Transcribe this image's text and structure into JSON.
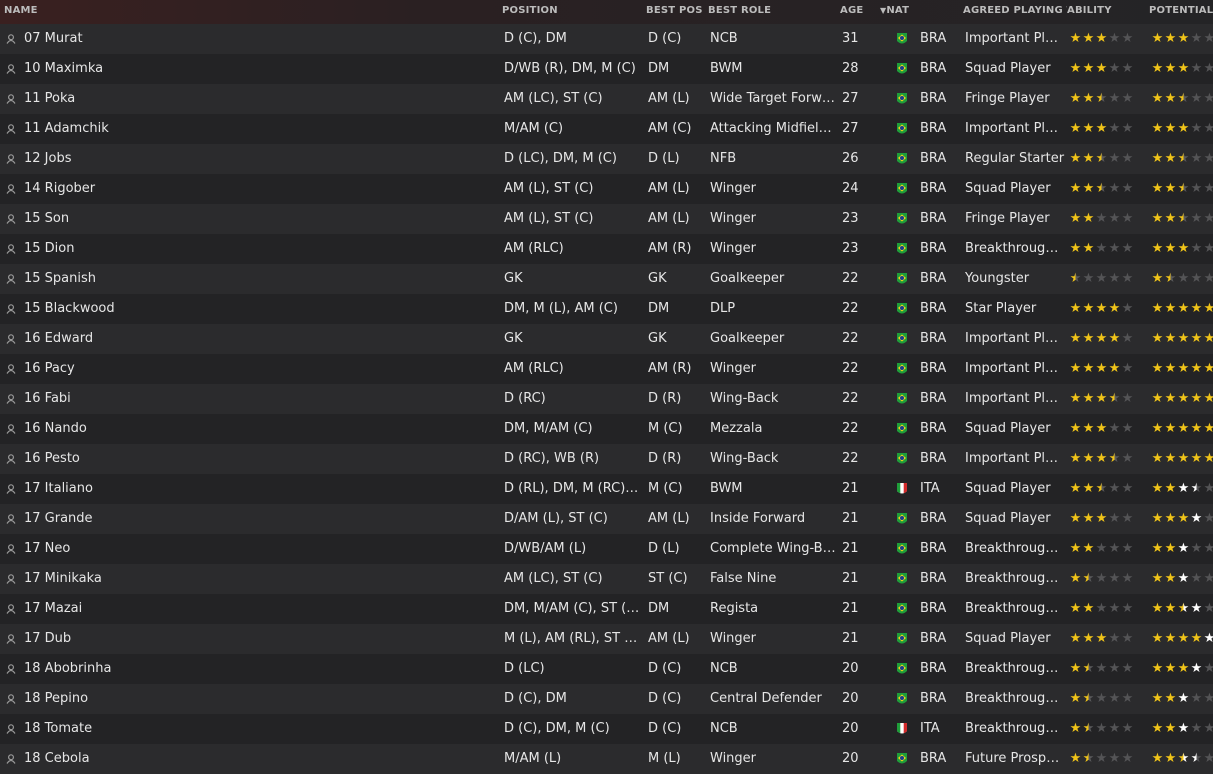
{
  "headers": {
    "name": "NAME",
    "position": "POSITION",
    "best_pos": "BEST POS",
    "best_role": "BEST ROLE",
    "age": "AGE",
    "nat": "NAT",
    "apt": "AGREED PLAYING T...",
    "ability": "ABILITY",
    "potential": "POTENTIAL"
  },
  "colors": {
    "gold": "#f0c419",
    "white": "#ffffff",
    "empty": "#545456"
  },
  "rows": [
    {
      "name": "07 Murat",
      "position": "D (C), DM",
      "best_pos": "D (C)",
      "best_role": "NCB",
      "age": "31",
      "nat": "BRA",
      "apt": "Important Player",
      "ability": [
        3,
        0,
        0
      ],
      "potential": [
        3,
        0,
        0
      ]
    },
    {
      "name": "10 Maximka",
      "position": "D/WB (R), DM, M (C)",
      "best_pos": "DM",
      "best_role": "BWM",
      "age": "28",
      "nat": "BRA",
      "apt": "Squad Player",
      "ability": [
        3,
        0,
        0
      ],
      "potential": [
        3,
        0,
        0
      ]
    },
    {
      "name": "11 Poka",
      "position": "AM (LC), ST (C)",
      "best_pos": "AM (L)",
      "best_role": "Wide Target Forward",
      "age": "27",
      "nat": "BRA",
      "apt": "Fringe Player",
      "ability": [
        2.5,
        0,
        0
      ],
      "potential": [
        2.5,
        0,
        0
      ]
    },
    {
      "name": "11 Adamchik",
      "position": "M/AM (C)",
      "best_pos": "AM (C)",
      "best_role": "Attacking Midfielder",
      "age": "27",
      "nat": "BRA",
      "apt": "Important Player",
      "ability": [
        3,
        0,
        0
      ],
      "potential": [
        3,
        0,
        0
      ]
    },
    {
      "name": "12 Jobs",
      "position": "D (LC), DM, M (C)",
      "best_pos": "D (L)",
      "best_role": "NFB",
      "age": "26",
      "nat": "BRA",
      "apt": "Regular Starter",
      "ability": [
        2.5,
        0,
        0
      ],
      "potential": [
        2.5,
        0,
        0
      ]
    },
    {
      "name": "14 Rigober",
      "position": "AM (L), ST (C)",
      "best_pos": "AM (L)",
      "best_role": "Winger",
      "age": "24",
      "nat": "BRA",
      "apt": "Squad Player",
      "ability": [
        2.5,
        0,
        0
      ],
      "potential": [
        2.5,
        0,
        0
      ]
    },
    {
      "name": "15 Son",
      "position": "AM (L), ST (C)",
      "best_pos": "AM (L)",
      "best_role": "Winger",
      "age": "23",
      "nat": "BRA",
      "apt": "Fringe Player",
      "ability": [
        2,
        0,
        0
      ],
      "potential": [
        2.5,
        0,
        0
      ]
    },
    {
      "name": "15 Dion",
      "position": "AM (RLC)",
      "best_pos": "AM (R)",
      "best_role": "Winger",
      "age": "23",
      "nat": "BRA",
      "apt": "Breakthrough...",
      "ability": [
        2,
        0,
        0
      ],
      "potential": [
        3,
        0,
        0
      ]
    },
    {
      "name": "15 Spanish",
      "position": "GK",
      "best_pos": "GK",
      "best_role": "Goalkeeper",
      "age": "22",
      "nat": "BRA",
      "apt": "Youngster",
      "ability": [
        0.5,
        0,
        0
      ],
      "potential": [
        1.5,
        0,
        0
      ]
    },
    {
      "name": "15 Blackwood",
      "position": "DM, M (L), AM (C)",
      "best_pos": "DM",
      "best_role": "DLP",
      "age": "22",
      "nat": "BRA",
      "apt": "Star Player",
      "ability": [
        4,
        0,
        0
      ],
      "potential": [
        5,
        0,
        0
      ]
    },
    {
      "name": "16 Edward",
      "position": "GK",
      "best_pos": "GK",
      "best_role": "Goalkeeper",
      "age": "22",
      "nat": "BRA",
      "apt": "Important Player",
      "ability": [
        4,
        0,
        0
      ],
      "potential": [
        5,
        0,
        0
      ]
    },
    {
      "name": "16 Pacy",
      "position": "AM (RLC)",
      "best_pos": "AM (R)",
      "best_role": "Winger",
      "age": "22",
      "nat": "BRA",
      "apt": "Important Player",
      "ability": [
        4,
        0,
        0
      ],
      "potential": [
        5,
        0,
        0
      ]
    },
    {
      "name": "16 Fabi",
      "position": "D (RC)",
      "best_pos": "D (R)",
      "best_role": "Wing-Back",
      "age": "22",
      "nat": "BRA",
      "apt": "Important Player",
      "ability": [
        3.5,
        0,
        0
      ],
      "potential": [
        5,
        0,
        0
      ]
    },
    {
      "name": "16 Nando",
      "position": "DM, M/AM (C)",
      "best_pos": "M (C)",
      "best_role": "Mezzala",
      "age": "22",
      "nat": "BRA",
      "apt": "Squad Player",
      "ability": [
        3,
        0,
        0
      ],
      "potential": [
        5,
        0,
        0
      ]
    },
    {
      "name": "16 Pesto",
      "position": "D (RC), WB (R)",
      "best_pos": "D (R)",
      "best_role": "Wing-Back",
      "age": "22",
      "nat": "BRA",
      "apt": "Important Player",
      "ability": [
        3.5,
        0,
        0
      ],
      "potential": [
        5,
        0,
        0
      ]
    },
    {
      "name": "17 Italiano",
      "position": "D (RL), DM, M (RC), A...",
      "best_pos": "M (C)",
      "best_role": "BWM",
      "age": "21",
      "nat": "ITA",
      "apt": "Squad Player",
      "ability": [
        2.5,
        0,
        0
      ],
      "potential": [
        2,
        1.5,
        0
      ]
    },
    {
      "name": "17 Grande",
      "position": "D/AM (L), ST (C)",
      "best_pos": "AM (L)",
      "best_role": "Inside Forward",
      "age": "21",
      "nat": "BRA",
      "apt": "Squad Player",
      "ability": [
        3,
        0,
        0
      ],
      "potential": [
        3,
        1,
        0
      ]
    },
    {
      "name": "17 Neo",
      "position": "D/WB/AM (L)",
      "best_pos": "D (L)",
      "best_role": "Complete Wing-Back",
      "age": "21",
      "nat": "BRA",
      "apt": "Breakthrough...",
      "ability": [
        2,
        0,
        0
      ],
      "potential": [
        2,
        1,
        0
      ]
    },
    {
      "name": "17 Minikaka",
      "position": "AM (LC), ST (C)",
      "best_pos": "ST (C)",
      "best_role": "False Nine",
      "age": "21",
      "nat": "BRA",
      "apt": "Breakthrough...",
      "ability": [
        1.5,
        0,
        0
      ],
      "potential": [
        2,
        1,
        0
      ]
    },
    {
      "name": "17 Mazai",
      "position": "DM, M/AM (C), ST (C)",
      "best_pos": "DM",
      "best_role": "Regista",
      "age": "21",
      "nat": "BRA",
      "apt": "Breakthrough...",
      "ability": [
        2,
        0,
        0
      ],
      "potential": [
        2.5,
        1.5,
        0
      ]
    },
    {
      "name": "17 Dub",
      "position": "M (L), AM (RL), ST (C)",
      "best_pos": "AM (L)",
      "best_role": "Winger",
      "age": "21",
      "nat": "BRA",
      "apt": "Squad Player",
      "ability": [
        3,
        0,
        0
      ],
      "potential": [
        4,
        1,
        0
      ]
    },
    {
      "name": "18 Abobrinha",
      "position": "D (LC)",
      "best_pos": "D (C)",
      "best_role": "NCB",
      "age": "20",
      "nat": "BRA",
      "apt": "Breakthrough...",
      "ability": [
        1.5,
        0,
        0
      ],
      "potential": [
        3,
        1,
        0
      ]
    },
    {
      "name": "18 Pepino",
      "position": "D (C), DM",
      "best_pos": "D (C)",
      "best_role": "Central Defender",
      "age": "20",
      "nat": "BRA",
      "apt": "Breakthrough...",
      "ability": [
        1.5,
        0,
        0
      ],
      "potential": [
        2,
        1,
        0
      ]
    },
    {
      "name": "18 Tomate",
      "position": "D (C), DM, M (C)",
      "best_pos": "D (C)",
      "best_role": "NCB",
      "age": "20",
      "nat": "ITA",
      "apt": "Breakthrough...",
      "ability": [
        1.5,
        0,
        0
      ],
      "potential": [
        2,
        1,
        0
      ]
    },
    {
      "name": "18 Cebola",
      "position": "M/AM (L)",
      "best_pos": "M (L)",
      "best_role": "Winger",
      "age": "20",
      "nat": "BRA",
      "apt": "Future Prospect",
      "ability": [
        1.5,
        0,
        0
      ],
      "potential": [
        2.5,
        1,
        0
      ]
    }
  ]
}
